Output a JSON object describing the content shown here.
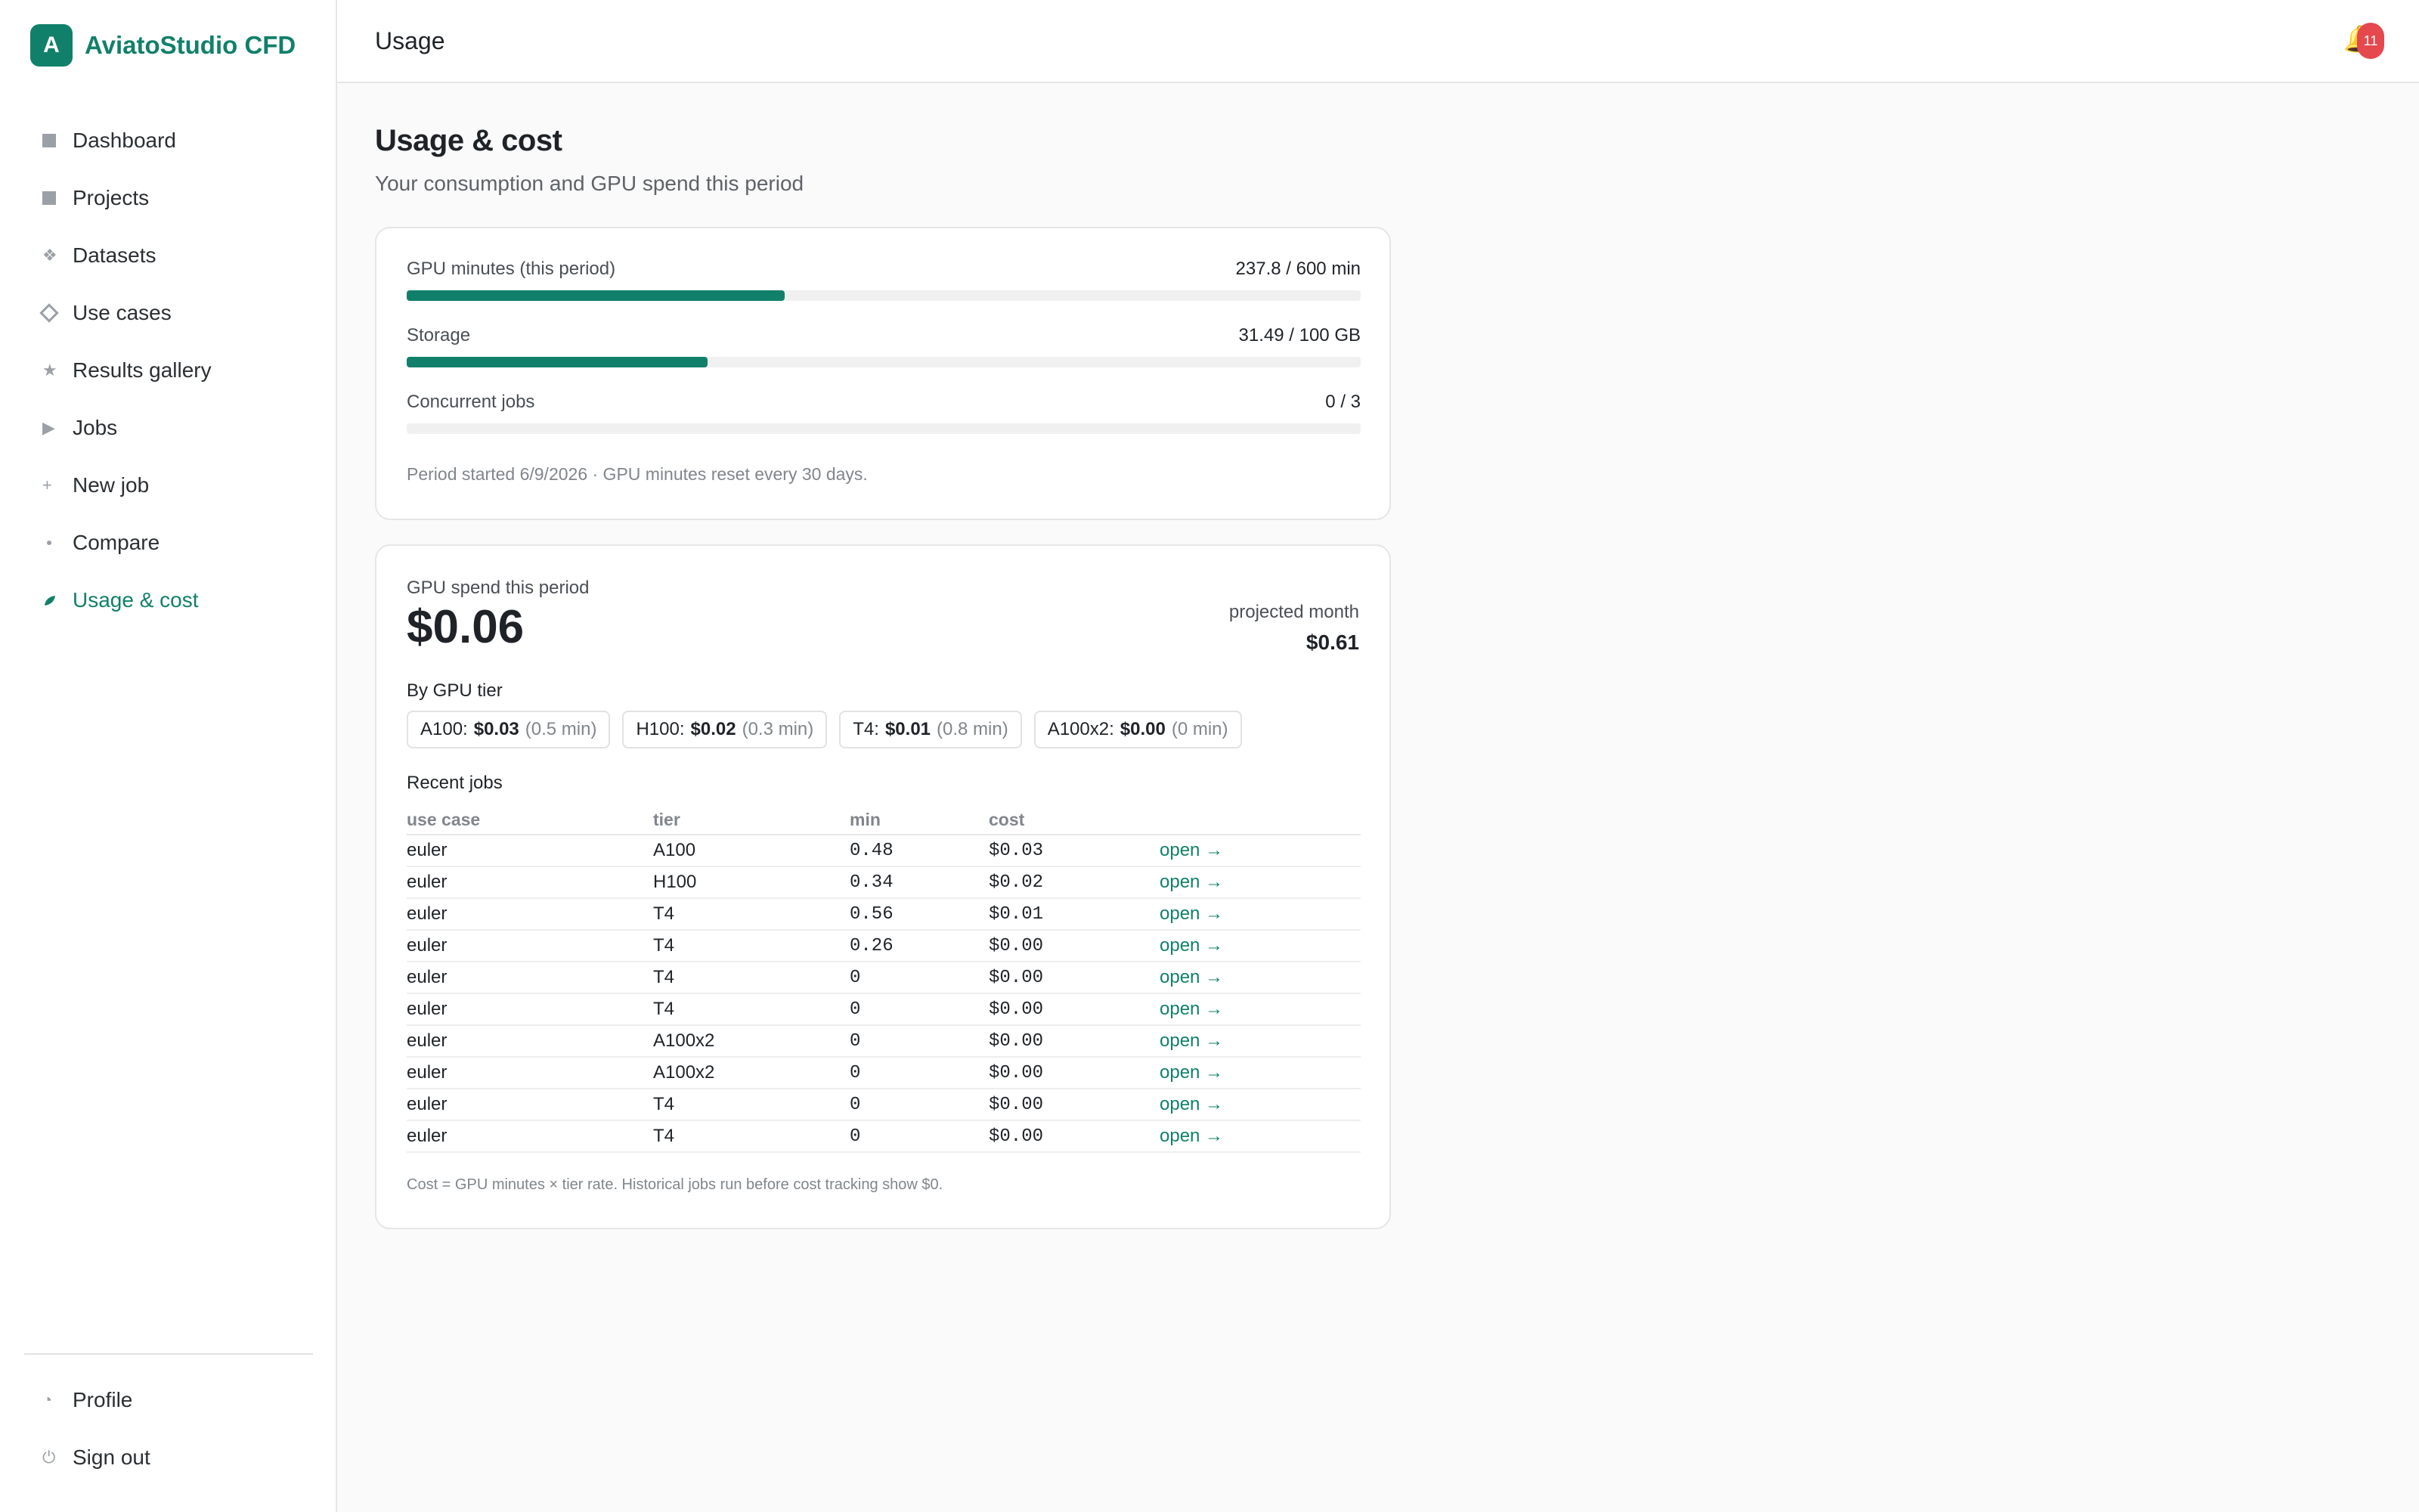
{
  "brand": {
    "logo_letter": "A",
    "name": "AviatoStudio CFD",
    "accent": "#11806a"
  },
  "nav": {
    "items": [
      {
        "label": "Dashboard",
        "icon": "square-icon"
      },
      {
        "label": "Projects",
        "icon": "square-icon"
      },
      {
        "label": "Datasets",
        "icon": "four-diamond-icon"
      },
      {
        "label": "Use cases",
        "icon": "diamond-outline-icon"
      },
      {
        "label": "Results gallery",
        "icon": "star-icon"
      },
      {
        "label": "Jobs",
        "icon": "play-icon"
      },
      {
        "label": "New job",
        "icon": "plus-icon"
      },
      {
        "label": "Compare",
        "icon": "dot-icon"
      },
      {
        "label": "Usage & cost",
        "icon": "leaf-icon",
        "active": true
      }
    ],
    "footer": [
      {
        "label": "Profile",
        "icon": "profile-icon"
      },
      {
        "label": "Sign out",
        "icon": "power-icon"
      }
    ]
  },
  "topbar": {
    "title": "Usage",
    "notifications_count": "11"
  },
  "page": {
    "title": "Usage & cost",
    "subtitle": "Your consumption and GPU spend this period"
  },
  "usage": {
    "meters": [
      {
        "label": "GPU minutes (this period)",
        "value": "237.8 / 600 min",
        "fraction": 0.396
      },
      {
        "label": "Storage",
        "value": "31.49 / 100 GB",
        "fraction": 0.315
      },
      {
        "label": "Concurrent jobs",
        "value": "0 / 3",
        "fraction": 0
      }
    ],
    "note": "Period started 6/9/2026 · GPU minutes reset every 30 days."
  },
  "spend": {
    "label": "GPU spend this period",
    "value": "$0.06",
    "projected_label": "projected month",
    "projected_value": "$0.61",
    "by_tier_label": "By GPU tier",
    "tiers": [
      {
        "name": "A100:",
        "cost": "$0.03",
        "minutes": "(0.5 min)"
      },
      {
        "name": "H100:",
        "cost": "$0.02",
        "minutes": "(0.3 min)"
      },
      {
        "name": "T4:",
        "cost": "$0.01",
        "minutes": "(0.8 min)"
      },
      {
        "name": "A100x2:",
        "cost": "$0.00",
        "minutes": "(0 min)"
      }
    ],
    "recent_label": "Recent jobs",
    "columns": [
      "use case",
      "tier",
      "min",
      "cost",
      ""
    ],
    "rows": [
      {
        "use_case": "euler",
        "tier": "A100",
        "min": "0.48",
        "cost": "$0.03",
        "link": "open →"
      },
      {
        "use_case": "euler",
        "tier": "H100",
        "min": "0.34",
        "cost": "$0.02",
        "link": "open →"
      },
      {
        "use_case": "euler",
        "tier": "T4",
        "min": "0.56",
        "cost": "$0.01",
        "link": "open →"
      },
      {
        "use_case": "euler",
        "tier": "T4",
        "min": "0.26",
        "cost": "$0.00",
        "link": "open →"
      },
      {
        "use_case": "euler",
        "tier": "T4",
        "min": "0",
        "cost": "$0.00",
        "link": "open →"
      },
      {
        "use_case": "euler",
        "tier": "T4",
        "min": "0",
        "cost": "$0.00",
        "link": "open →"
      },
      {
        "use_case": "euler",
        "tier": "A100x2",
        "min": "0",
        "cost": "$0.00",
        "link": "open →"
      },
      {
        "use_case": "euler",
        "tier": "A100x2",
        "min": "0",
        "cost": "$0.00",
        "link": "open →"
      },
      {
        "use_case": "euler",
        "tier": "T4",
        "min": "0",
        "cost": "$0.00",
        "link": "open →"
      },
      {
        "use_case": "euler",
        "tier": "T4",
        "min": "0",
        "cost": "$0.00",
        "link": "open →"
      }
    ],
    "footnote": "Cost = GPU minutes × tier rate. Historical jobs run before cost tracking show $0."
  }
}
